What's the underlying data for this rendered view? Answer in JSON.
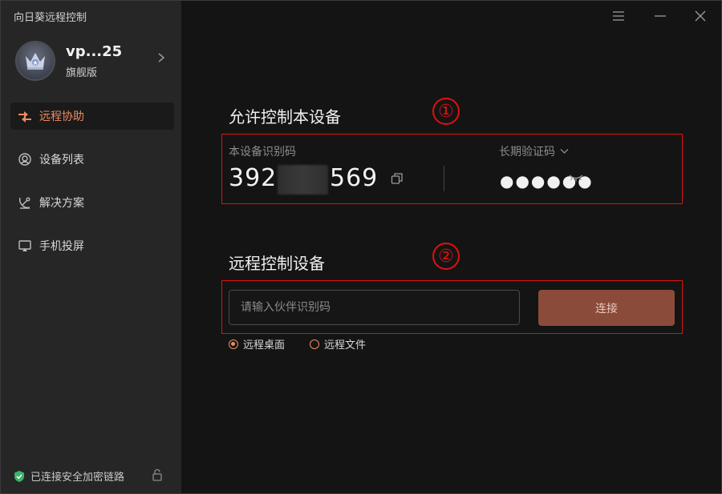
{
  "app": {
    "title": "向日葵远程控制"
  },
  "profile": {
    "name": "vp...25",
    "edition": "旗舰版"
  },
  "nav": [
    {
      "label": "远程协助",
      "icon": "remote-assist-icon",
      "active": true
    },
    {
      "label": "设备列表",
      "icon": "device-list-icon",
      "active": false
    },
    {
      "label": "解决方案",
      "icon": "solution-icon",
      "active": false
    },
    {
      "label": "手机投屏",
      "icon": "screen-cast-icon",
      "active": false
    }
  ],
  "status": {
    "text": "已连接安全加密链路"
  },
  "allow": {
    "title": "允许控制本设备",
    "marker": "①",
    "id_label": "本设备识别码",
    "id_prefix": "392",
    "id_suffix": "569",
    "code_label": "长期验证码",
    "code_value": "●●●●●●"
  },
  "remote": {
    "title": "远程控制设备",
    "marker": "②",
    "input_placeholder": "请输入伙伴识别码",
    "input_value": "",
    "connect_label": "连接",
    "modes": [
      {
        "label": "远程桌面",
        "selected": true
      },
      {
        "label": "远程文件",
        "selected": false
      }
    ]
  },
  "colors": {
    "accent": "#ef8b63",
    "connect_button": "#8b4b3a",
    "annotation": "#e01010"
  }
}
